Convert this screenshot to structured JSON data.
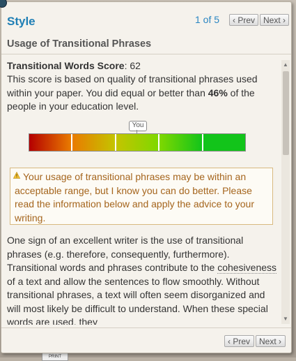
{
  "header": {
    "title": "Style",
    "page_indicator": "1 of 5",
    "prev_label": "‹ Prev",
    "next_label": "Next ›"
  },
  "section": {
    "title": "Usage of Transitional Phrases"
  },
  "score": {
    "label": "Transitional Words Score",
    "value": ": 62",
    "desc_before": "This score is based on quality of transitional phrases used within your paper. You did equal or better than ",
    "desc_percent": "46%",
    "desc_after": " of the people in your education level."
  },
  "meter": {
    "marker_label": "You",
    "segment_colors": [
      "#b40000",
      "#e97b00",
      "#c4c400",
      "#7fd800",
      "#12c41a"
    ]
  },
  "warning": {
    "text": "Your usage of transitional phrases may be within an acceptable range, but I know you can do better. Please read the information below and apply the advice to your writing."
  },
  "body": {
    "text_before": "One sign of an excellent writer is the use of transitional phrases (e.g. therefore, consequently, furthermore). Transitional words and phrases contribute to the ",
    "highlight": "cohesiveness",
    "text_after": " of a text and allow the sentences to flow smoothly. Without transitional phrases, a text will often seem disorganized and will most likely be difficult to understand. When these special words are used, they"
  },
  "footer": {
    "prev_label": "‹ Prev",
    "next_label": "Next ›"
  },
  "background": {
    "tab_label": "PRINT"
  },
  "colors": {
    "title": "#1f7fb5",
    "warning_text": "#a5651d",
    "warning_border": "#d8b97f"
  }
}
